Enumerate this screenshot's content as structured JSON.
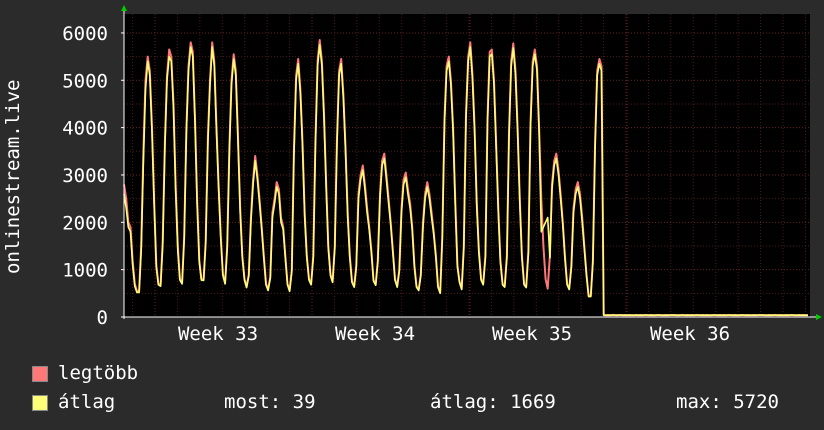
{
  "chart_data": {
    "type": "line",
    "ylabel": "onlinestream.live",
    "y_ticks": [
      "0",
      "1000",
      "2000",
      "3000",
      "4000",
      "5000",
      "6000"
    ],
    "ylim": [
      0,
      6400
    ],
    "x_ticks": [
      "Week 33",
      "Week 34",
      "Week 35",
      "Week 36"
    ],
    "grid": true,
    "colors": {
      "background": "#2b2b2b",
      "plot_bg": "#000000",
      "grid_minor": "#4a1a1a",
      "grid_major": "#6b2020",
      "axis": "#ffffff",
      "arrow": "#00cc00",
      "max_series": "#ff7777",
      "avg_series": "#ffff77"
    },
    "series": [
      {
        "name": "legtöbb",
        "color": "#ff7777",
        "values": [
          2800,
          2500,
          2000,
          1900,
          1200,
          700,
          550,
          540,
          1500,
          3500,
          5000,
          5500,
          5200,
          4000,
          2500,
          1100,
          700,
          680,
          1600,
          3700,
          5100,
          5650,
          5500,
          4500,
          2800,
          1500,
          800,
          720,
          1700,
          4000,
          5300,
          5800,
          5600,
          4200,
          2500,
          1200,
          800,
          790,
          1600,
          3800,
          5000,
          5800,
          5400,
          4000,
          2800,
          1700,
          900,
          720,
          1500,
          3600,
          5000,
          5550,
          5200,
          3800,
          2300,
          1300,
          800,
          640,
          900,
          2100,
          2900,
          3400,
          3000,
          2500,
          1900,
          1300,
          700,
          580,
          850,
          2200,
          2500,
          2850,
          2700,
          2100,
          1900,
          1300,
          700,
          560,
          1000,
          3500,
          5100,
          5450,
          4800,
          3700,
          2200,
          1300,
          800,
          700,
          1300,
          3700,
          5400,
          5850,
          5400,
          4300,
          2800,
          1500,
          900,
          750,
          1500,
          3700,
          5200,
          5450,
          4700,
          3600,
          2200,
          1300,
          750,
          650,
          1100,
          2600,
          3000,
          3200,
          2800,
          2300,
          1900,
          1400,
          780,
          690,
          1200,
          2600,
          3300,
          3450,
          3000,
          2500,
          2000,
          1400,
          800,
          650,
          1000,
          2300,
          2900,
          3050,
          2700,
          2400,
          1900,
          1100,
          650,
          580,
          900,
          2000,
          2600,
          2850,
          2600,
          2200,
          1800,
          1300,
          650,
          520,
          1700,
          4200,
          5300,
          5500,
          5000,
          4000,
          2500,
          1100,
          750,
          600,
          1500,
          4300,
          5500,
          5800,
          5100,
          4000,
          2400,
          1400,
          800,
          700,
          1300,
          4200,
          5600,
          5650,
          5000,
          3700,
          2300,
          1200,
          700,
          650,
          1300,
          3900,
          5400,
          5780,
          5200,
          4000,
          2500,
          1300,
          700,
          640,
          1400,
          4100,
          5400,
          5650,
          5300,
          4000,
          2500,
          1500,
          800,
          600,
          1300,
          2800,
          3300,
          3450,
          3100,
          2600,
          2000,
          1300,
          700,
          600,
          1100,
          2300,
          2700,
          2850,
          2600,
          2100,
          1500,
          900,
          450,
          450,
          1200,
          3700,
          5200,
          5450,
          5300,
          40,
          38,
          40,
          37,
          42,
          40,
          39,
          40,
          41,
          38,
          40,
          39,
          40,
          37,
          39,
          40,
          38,
          40,
          39,
          41,
          40,
          39,
          40,
          38,
          39,
          41,
          40,
          39,
          38,
          40,
          39,
          40,
          41,
          40,
          38,
          39,
          40,
          41,
          39,
          40,
          38,
          40,
          39,
          40,
          41,
          39,
          40,
          38,
          40,
          39,
          39,
          40,
          41,
          38,
          40,
          39,
          40,
          39,
          41,
          40,
          39,
          40,
          38,
          39,
          40,
          41,
          39,
          40,
          38,
          39,
          40,
          39,
          40,
          41,
          40,
          39,
          38,
          40,
          39,
          40,
          41,
          39,
          40,
          38,
          39,
          40,
          39,
          41,
          40,
          39,
          38,
          40,
          39,
          40,
          39,
          39
        ]
      },
      {
        "name": "átlag",
        "color": "#ffff77",
        "values": [
          2600,
          2300,
          1900,
          1800,
          1100,
          650,
          520,
          520,
          1400,
          3300,
          4800,
          5400,
          5100,
          3900,
          2400,
          1050,
          680,
          650,
          1500,
          3600,
          5000,
          5500,
          5400,
          4400,
          2700,
          1400,
          780,
          700,
          1650,
          3900,
          5200,
          5700,
          5500,
          4100,
          2400,
          1150,
          780,
          770,
          1550,
          3700,
          4900,
          5700,
          5300,
          3900,
          2700,
          1650,
          880,
          700,
          1450,
          3500,
          4900,
          5450,
          5100,
          3700,
          2200,
          1250,
          780,
          620,
          870,
          2000,
          2800,
          3300,
          2900,
          2400,
          1850,
          1250,
          680,
          560,
          820,
          2100,
          2400,
          2750,
          2600,
          2000,
          1850,
          1250,
          680,
          540,
          950,
          3400,
          5000,
          5350,
          4700,
          3600,
          2100,
          1250,
          780,
          680,
          1250,
          3600,
          5300,
          5750,
          5300,
          4200,
          2700,
          1450,
          870,
          730,
          1450,
          3600,
          5100,
          5350,
          4600,
          3500,
          2100,
          1250,
          730,
          630,
          1050,
          2500,
          2900,
          3100,
          2700,
          2200,
          1850,
          1350,
          760,
          670,
          1150,
          2500,
          3200,
          3350,
          2900,
          2400,
          1950,
          1350,
          780,
          630,
          970,
          2200,
          2800,
          2950,
          2600,
          2300,
          1850,
          1050,
          630,
          560,
          870,
          1900,
          2500,
          2750,
          2500,
          2100,
          1750,
          1250,
          630,
          500,
          1650,
          4100,
          5200,
          5400,
          4900,
          3900,
          2400,
          1050,
          730,
          580,
          1450,
          4200,
          5400,
          5700,
          5000,
          3900,
          2300,
          1350,
          780,
          680,
          1250,
          4100,
          5500,
          5550,
          4900,
          3600,
          2200,
          1150,
          680,
          630,
          1250,
          3800,
          5300,
          5680,
          5100,
          3900,
          2400,
          1250,
          680,
          620,
          1350,
          4000,
          5300,
          5550,
          5200,
          3900,
          1800,
          1900,
          2000,
          2100,
          1250,
          2700,
          3200,
          3350,
          3000,
          2500,
          1950,
          1250,
          680,
          580,
          1050,
          2200,
          2600,
          2750,
          2500,
          2000,
          1450,
          870,
          430,
          430,
          1150,
          3600,
          5100,
          5350,
          5200,
          40,
          38,
          40,
          37,
          42,
          40,
          39,
          40,
          41,
          38,
          40,
          39,
          40,
          37,
          39,
          40,
          38,
          40,
          39,
          41,
          40,
          39,
          40,
          38,
          39,
          41,
          40,
          39,
          38,
          40,
          39,
          40,
          41,
          40,
          38,
          39,
          40,
          41,
          39,
          40,
          38,
          40,
          39,
          40,
          41,
          39,
          40,
          38,
          40,
          39,
          39,
          40,
          41,
          38,
          40,
          39,
          40,
          39,
          41,
          40,
          39,
          40,
          38,
          39,
          40,
          41,
          39,
          40,
          38,
          39,
          40,
          39,
          40,
          41,
          40,
          39,
          38,
          40,
          39,
          40,
          41,
          39,
          40,
          38,
          39,
          40,
          39,
          41,
          40,
          39,
          38,
          40,
          39,
          40,
          39,
          39
        ]
      }
    ]
  },
  "legend": [
    {
      "label": "legtöbb",
      "color": "#ff7777"
    },
    {
      "label": "átlag",
      "color": "#ffff77"
    }
  ],
  "stats": {
    "now": "most: 39",
    "avg": "átlag: 1669",
    "max": "max: 5720"
  }
}
